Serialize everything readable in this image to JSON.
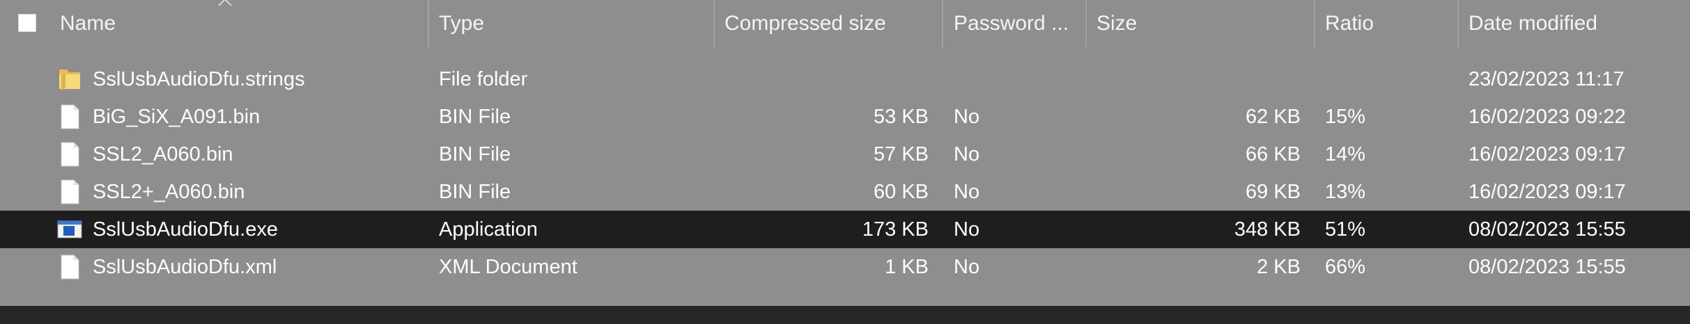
{
  "columns": {
    "name": "Name",
    "type": "Type",
    "compressed_size": "Compressed size",
    "password": "Password ...",
    "size": "Size",
    "ratio": "Ratio",
    "date_modified": "Date modified"
  },
  "files": [
    {
      "icon": "folder-icon",
      "name": "SslUsbAudioDfu.strings",
      "type": "File folder",
      "compressed_size": "",
      "password": "",
      "size": "",
      "ratio": "",
      "date_modified": "23/02/2023 11:17",
      "selected": false
    },
    {
      "icon": "file-icon",
      "name": "BiG_SiX_A091.bin",
      "type": "BIN File",
      "compressed_size": "53 KB",
      "password": "No",
      "size": "62 KB",
      "ratio": "15%",
      "date_modified": "16/02/2023 09:22",
      "selected": false
    },
    {
      "icon": "file-icon",
      "name": "SSL2_A060.bin",
      "type": "BIN File",
      "compressed_size": "57 KB",
      "password": "No",
      "size": "66 KB",
      "ratio": "14%",
      "date_modified": "16/02/2023 09:17",
      "selected": false
    },
    {
      "icon": "file-icon",
      "name": "SSL2+_A060.bin",
      "type": "BIN File",
      "compressed_size": "60 KB",
      "password": "No",
      "size": "69 KB",
      "ratio": "13%",
      "date_modified": "16/02/2023 09:17",
      "selected": false
    },
    {
      "icon": "application-icon",
      "name": "SslUsbAudioDfu.exe",
      "type": "Application",
      "compressed_size": "173 KB",
      "password": "No",
      "size": "348 KB",
      "ratio": "51%",
      "date_modified": "08/02/2023 15:55",
      "selected": true
    },
    {
      "icon": "file-icon",
      "name": "SslUsbAudioDfu.xml",
      "type": "XML Document",
      "compressed_size": "1 KB",
      "password": "No",
      "size": "2 KB",
      "ratio": "66%",
      "date_modified": "08/02/2023 15:55",
      "selected": false
    }
  ]
}
